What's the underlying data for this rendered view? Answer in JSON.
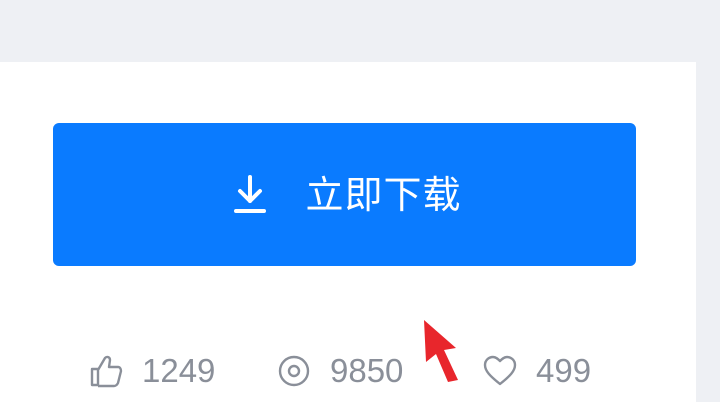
{
  "download": {
    "label": "立即下载",
    "icon": "download-icon"
  },
  "stats": {
    "likes": "1249",
    "views": "9850",
    "favorites": "499"
  },
  "colors": {
    "background": "#eef0f4",
    "card": "#ffffff",
    "button": "#0a7bff",
    "stat_text": "#8a8f99",
    "arrow": "#e8262c"
  }
}
